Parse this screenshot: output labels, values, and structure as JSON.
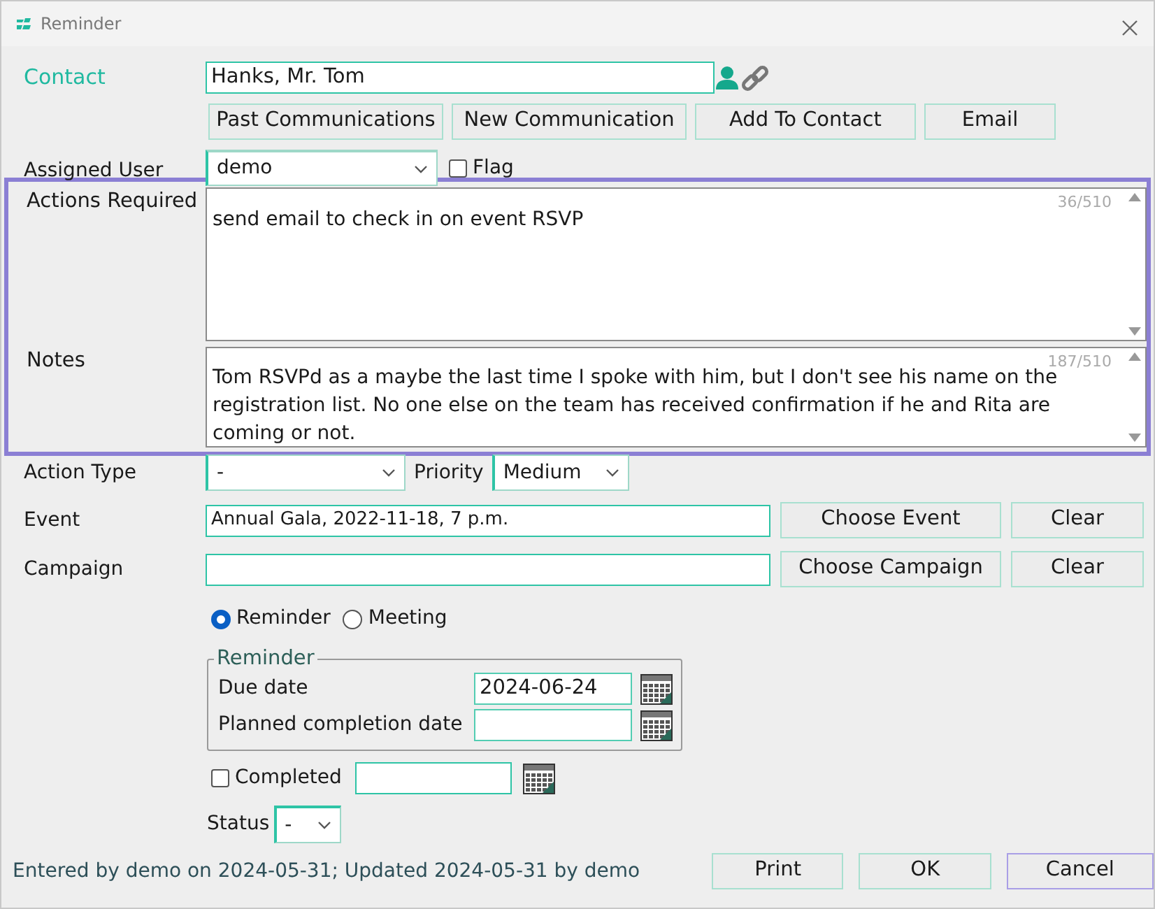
{
  "window": {
    "title": "Reminder"
  },
  "contact": {
    "label": "Contact",
    "value": "Hanks, Mr. Tom"
  },
  "contact_buttons": [
    {
      "label": "Past Communications"
    },
    {
      "label": "New Communication"
    },
    {
      "label": "Add To Contact"
    },
    {
      "label": "Email"
    }
  ],
  "assigned_user": {
    "label": "Assigned User",
    "value": "demo"
  },
  "flag": {
    "label": "Flag",
    "checked": false
  },
  "actions_required": {
    "label": "Actions Required",
    "value": "send email to check in on event RSVP",
    "counter": "36/510"
  },
  "notes": {
    "label": "Notes",
    "value": "Tom RSVPd as a maybe the last time I spoke with him, but I don't see his name on the registration list. No one else on the team has received confirmation if he and Rita are coming or not.",
    "counter": "187/510"
  },
  "action_type": {
    "label": "Action Type",
    "value": "-"
  },
  "priority": {
    "label": "Priority",
    "value": "Medium"
  },
  "event": {
    "label": "Event",
    "value": "Annual Gala, 2022-11-18, 7 p.m.",
    "buttons": [
      "Choose Event",
      "Clear"
    ]
  },
  "campaign": {
    "label": "Campaign",
    "buttons": [
      "Choose Campaign",
      "Clear"
    ]
  },
  "mode_options": [
    {
      "label": "Reminder",
      "selected": true
    },
    {
      "label": "Meeting",
      "selected": false
    }
  ],
  "reminder_group": {
    "legend": "Reminder",
    "fields": [
      {
        "label": "Due date",
        "value": "2024-06-24"
      },
      {
        "label": "Planned completion date"
      }
    ]
  },
  "completed": {
    "label": "Completed",
    "checked": false
  },
  "status": {
    "label": "Status",
    "value": "-"
  },
  "footer": {
    "text": "Entered by demo on 2024-05-31; Updated 2024-05-31 by demo",
    "buttons": [
      {
        "label": "Print",
        "focused": false
      },
      {
        "label": "OK",
        "focused": false
      },
      {
        "label": "Cancel",
        "focused": true
      }
    ]
  }
}
